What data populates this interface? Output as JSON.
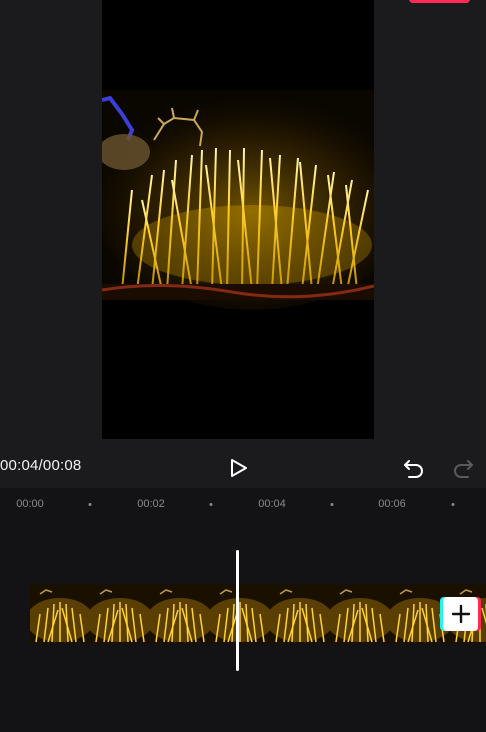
{
  "preview": {
    "export_button_color": "#fe2c55",
    "image_description": "golden wheat light installation"
  },
  "controls": {
    "time": "00:04/00:08",
    "play_icon": "play-icon",
    "undo_icon": "undo-icon",
    "redo_icon": "redo-icon"
  },
  "timeline": {
    "ruler": {
      "labels": [
        "00:00",
        "00:02",
        "00:04",
        "00:06"
      ]
    },
    "clip_count": 8,
    "add_icon": "plus-icon"
  },
  "colors": {
    "background": "#1b1b1d",
    "timeline_background": "#131315",
    "accent_red": "#fe2c55",
    "accent_cyan": "#25f4ee"
  }
}
